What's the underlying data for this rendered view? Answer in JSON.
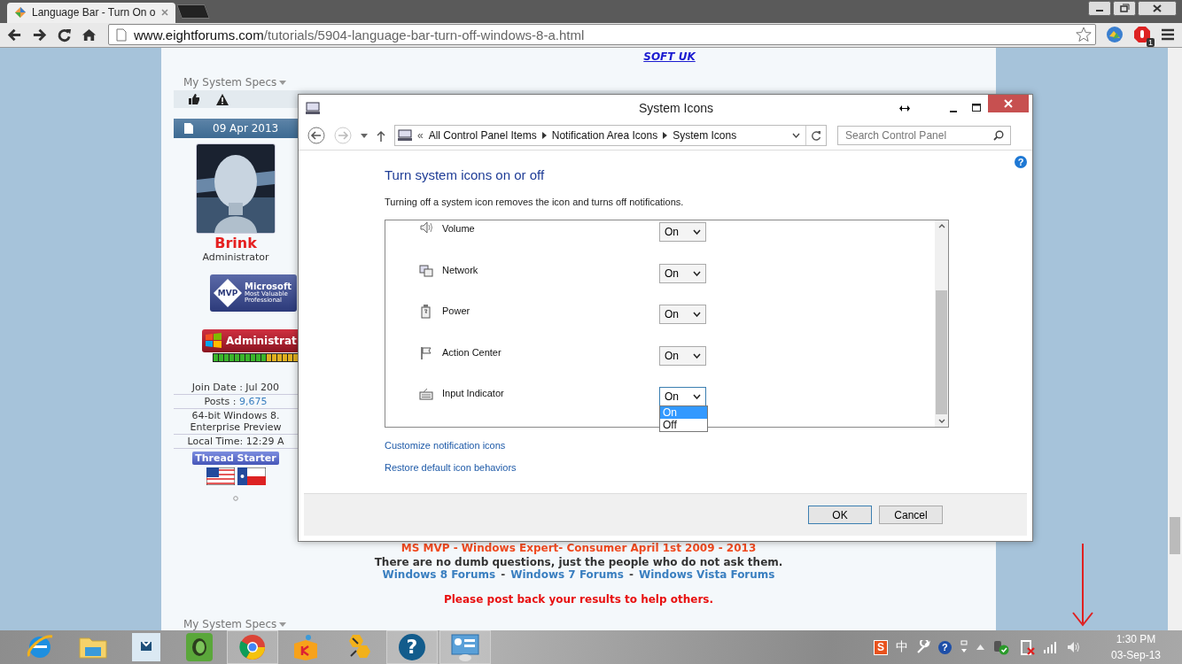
{
  "browser": {
    "tab_title": "Language Bar - Turn On o",
    "url_domain": "www.eightforums.com",
    "url_path": "/tutorials/5904-language-bar-turn-off-windows-8-a.html",
    "extension_badge": "1"
  },
  "forum": {
    "top_link": "SOFT UK",
    "specs_label": "My System Specs",
    "post_date": "09 Apr 2013",
    "user": {
      "name": "Brink",
      "role": "Administrator",
      "mvp_mark": "MVP",
      "mvp_title": "Microsoft",
      "mvp_line1": "Most Valuable",
      "mvp_line2": "Professional",
      "rank": "Administrat",
      "details": [
        {
          "text": "Join Date : Jul 200"
        },
        {
          "text": "Posts : ",
          "link": "9,675"
        },
        {
          "text": "64-bit Windows 8.\nEnterprise Preview"
        },
        {
          "text": "Local Time: 12:29 A"
        }
      ],
      "thread_starter": "Thread Starter"
    },
    "signature": "MS MVP - Windows Expert- Consumer April 1st 2009 - 2013",
    "quote": "There are no dumb questions, just the people who do not ask them.",
    "forum_links": [
      "Windows 8 Forums",
      "Windows 7 Forums",
      "Windows Vista Forums"
    ],
    "link_separator": "-",
    "call_to_action": "Please post back your results to help others.",
    "specs_label_bottom": "My System Specs"
  },
  "dialog": {
    "title": "System Icons",
    "breadcrumb_prefix": "«",
    "breadcrumb": [
      "All Control Panel Items",
      "Notification Area Icons",
      "System Icons"
    ],
    "search_placeholder": "Search Control Panel",
    "help_glyph": "?",
    "heading": "Turn system icons on or off",
    "description": "Turning off a system icon removes the icon and turns off notifications.",
    "icons": [
      {
        "kind": "volume",
        "name": "Volume",
        "value": "On",
        "open": false
      },
      {
        "kind": "network",
        "name": "Network",
        "value": "On",
        "open": false
      },
      {
        "kind": "power",
        "name": "Power",
        "value": "On",
        "open": false
      },
      {
        "kind": "action-center",
        "name": "Action Center",
        "value": "On",
        "open": false
      },
      {
        "kind": "input",
        "name": "Input Indicator",
        "value": "On",
        "open": true,
        "options": [
          {
            "label": "On",
            "selected": true
          },
          {
            "label": "Off",
            "selected": false
          }
        ]
      }
    ],
    "links": [
      "Customize notification icons",
      "Restore default icon behaviors"
    ],
    "buttons": [
      {
        "label": "OK",
        "default": true
      },
      {
        "label": "Cancel",
        "default": false
      }
    ]
  },
  "taskbar": {
    "apps": [
      {
        "kind": "ie",
        "open": false
      },
      {
        "kind": "folder",
        "open": false
      },
      {
        "kind": "store",
        "open": false
      },
      {
        "kind": "evernote",
        "open": false
      },
      {
        "kind": "chrome",
        "open": true
      },
      {
        "kind": "box",
        "open": false
      },
      {
        "kind": "keys",
        "open": false
      },
      {
        "kind": "help",
        "open": true
      },
      {
        "kind": "control-panel",
        "open": true
      }
    ],
    "help_glyph": "?",
    "tray_s": "S",
    "ime": "中",
    "tray_help": "?",
    "time": "1:30 PM",
    "date": "03-Sep-13"
  }
}
